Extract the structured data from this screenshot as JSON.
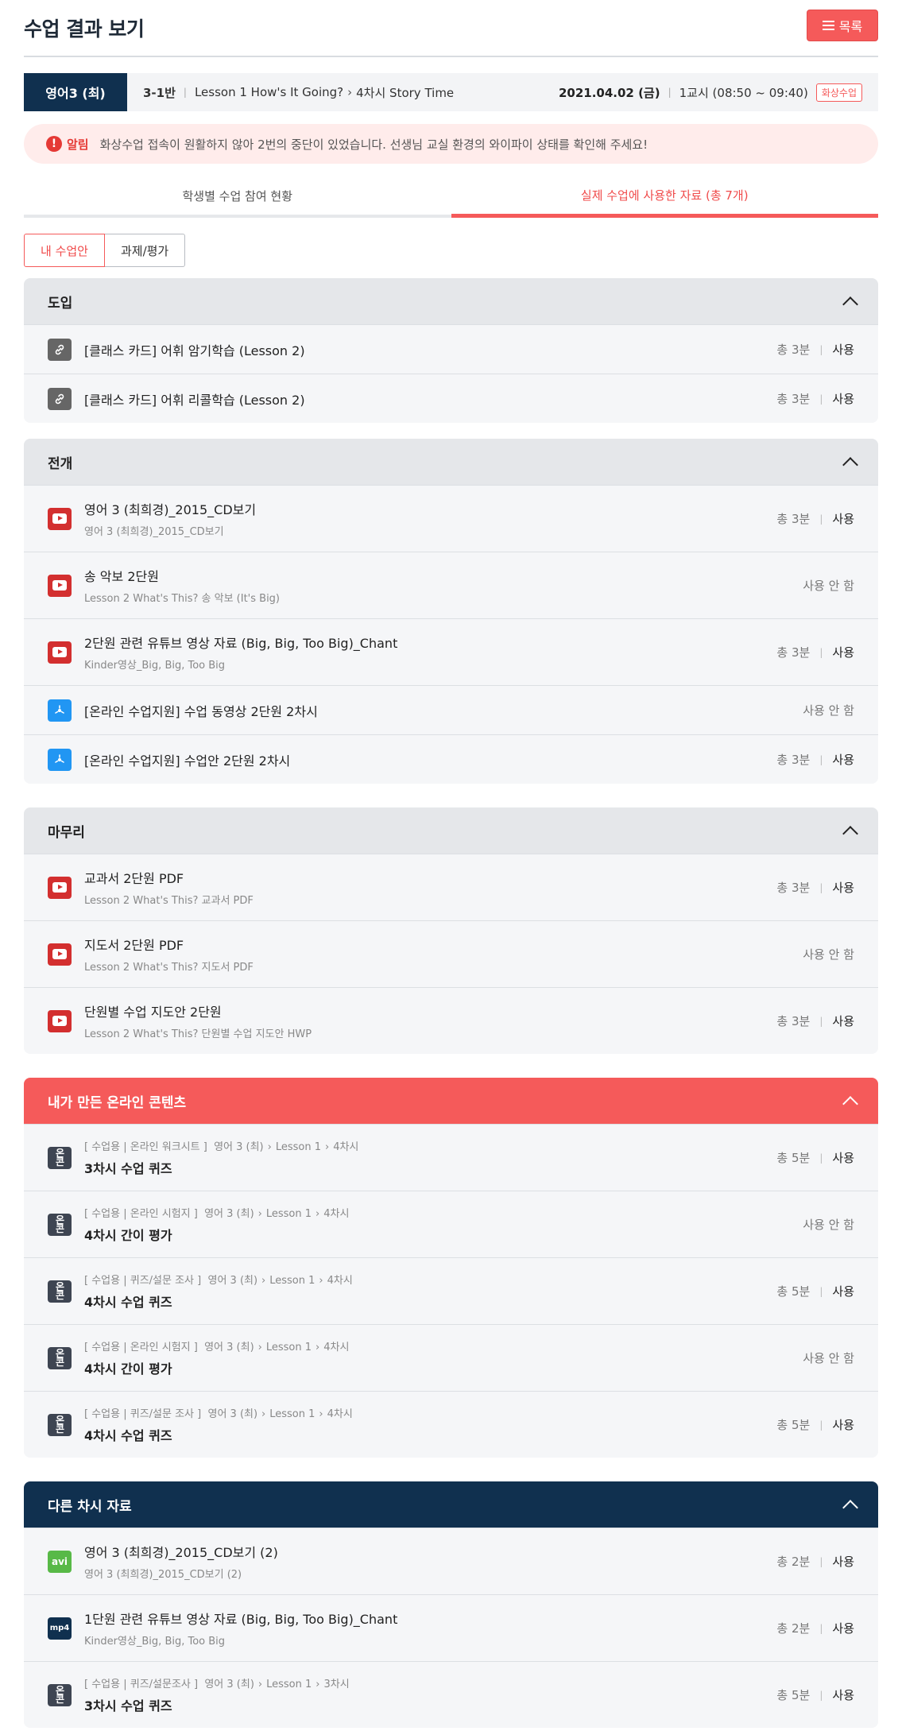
{
  "header": {
    "title": "수업 결과 보기",
    "list_button": "목록"
  },
  "classbar": {
    "subject": "영어3 (최)",
    "class_name": "3-1반",
    "lesson": "Lesson 1 How's It Going?",
    "period": "4차시 Story Time",
    "date": "2021.04.02 (금)",
    "time": "1교시 (08:50 ~ 09:40)",
    "badge": "화상수업"
  },
  "alert": {
    "label": "알림",
    "message": "화상수업 접속이 원활하지 않아 2번의 중단이 있었습니다. 선생님 교실 환경의 와이파이 상태를 확인해 주세요!"
  },
  "tabs": [
    {
      "label": "학생별 수업 참여 현황"
    },
    {
      "label": "실제 수업에 사용한 자료 (총 7개)"
    }
  ],
  "subtabs": [
    {
      "label": "내 수업안"
    },
    {
      "label": "과제/평가"
    }
  ],
  "sections": [
    {
      "title": "도입",
      "rows": [
        {
          "icon": "link-icon",
          "title": "[클래스 카드] 어휘 암기학습 (Lesson 2)",
          "time": "총 3분",
          "status": "사용"
        },
        {
          "icon": "link-icon",
          "title": "[클래스 카드] 어휘 리콜학습 (Lesson 2)",
          "time": "총 3분",
          "status": "사용"
        }
      ]
    },
    {
      "title": "전개",
      "rows": [
        {
          "icon": "youtube-icon",
          "title": "영어 3 (최희경)_2015_CD보기",
          "sub": "영어 3 (최희경)_2015_CD보기",
          "time": "총 3분",
          "status": "사용"
        },
        {
          "icon": "youtube-icon",
          "title": "송 악보 2단원",
          "sub": "Lesson 2 What's This? 송 악보 (It's Big)",
          "status_unused": "사용 안 함"
        },
        {
          "icon": "youtube-icon",
          "title": "2단원 관련 유튜브 영상 자료 (Big, Big, Too Big)_Chant",
          "sub": "Kinder영상_Big, Big, Too Big",
          "time": "총 3분",
          "status": "사용"
        },
        {
          "icon": "online-support-icon",
          "title": "[온라인 수업지원] 수업 동영상 2단원 2차시",
          "status_unused": "사용 안 함"
        },
        {
          "icon": "online-support-icon",
          "title": "[온라인 수업지원] 수업안 2단원 2차시",
          "time": "총 3분",
          "status": "사용"
        }
      ]
    },
    {
      "title": "마무리",
      "rows": [
        {
          "icon": "youtube-icon",
          "title": "교과서 2단원 PDF",
          "sub": "Lesson 2 What's This? 교과서 PDF",
          "time": "총 3분",
          "status": "사용"
        },
        {
          "icon": "youtube-icon",
          "title": "지도서 2단원 PDF",
          "sub": "Lesson 2 What's This? 지도서 PDF",
          "status_unused": "사용 안 함"
        },
        {
          "icon": "youtube-icon",
          "title": "단원별 수업 지도안 2단원",
          "sub": "Lesson 2 What's This? 단원별 수업 지도안 HWP",
          "time": "총 3분",
          "status": "사용"
        }
      ]
    },
    {
      "title": "내가 만든 온라인 콘텐츠",
      "rows": [
        {
          "icon_text": "온|콘",
          "tag": "[ 수업용 | 온라인 워크시트 ]",
          "subject": "영어 3 (최)",
          "lesson": "Lesson 1",
          "period": "4차시",
          "title": "3차시 수업 퀴즈",
          "time": "총 5분",
          "status": "사용"
        },
        {
          "icon_text": "온|콘",
          "tag": "[ 수업용 | 온라인 시험지 ]",
          "subject": "영어 3 (최)",
          "lesson": "Lesson 1",
          "period": "4차시",
          "title": "4차시 간이 평가",
          "status_unused": "사용 안 함"
        },
        {
          "icon_text": "온|콘",
          "tag": "[ 수업용 | 퀴즈/설문 조사 ]",
          "subject": "영어 3 (최)",
          "lesson": "Lesson 1",
          "period": "4차시",
          "title": "4차시 수업 퀴즈",
          "time": "총 5분",
          "status": "사용"
        },
        {
          "icon_text": "온|콘",
          "tag": "[ 수업용 | 온라인 시험지 ]",
          "subject": "영어 3 (최)",
          "lesson": "Lesson 1",
          "period": "4차시",
          "title": "4차시 간이 평가",
          "status_unused": "사용 안 함"
        },
        {
          "icon_text": "온|콘",
          "tag": "[ 수업용 | 퀴즈/설문 조사 ]",
          "subject": "영어 3 (최)",
          "lesson": "Lesson 1",
          "period": "4차시",
          "title": "4차시 수업 퀴즈",
          "time": "총 5분",
          "status": "사용"
        }
      ]
    },
    {
      "title": "다른 차시 자료",
      "rows": [
        {
          "icon_text": "avi",
          "title": "영어 3 (최희경)_2015_CD보기 (2)",
          "sub": "영어 3 (최희경)_2015_CD보기 (2)",
          "time": "총 2분",
          "status": "사용"
        },
        {
          "icon_text": "mp4",
          "title": "1단원 관련 유튜브 영상 자료 (Big, Big, Too Big)_Chant",
          "sub": "Kinder영상_Big, Big, Too Big",
          "time": "총 2분",
          "status": "사용"
        },
        {
          "icon_text": "온|콘",
          "tag": "[ 수업용 | 퀴즈/설문조사 ]",
          "subject": "영어 3 (최)",
          "lesson": "Lesson 1",
          "period": "3차시",
          "title": "3차시 수업 퀴즈",
          "time": "총 5분",
          "status": "사용"
        }
      ]
    }
  ],
  "colors": {
    "accent": "#f55a5a",
    "navy": "#10304f",
    "youtube": "#d32f2f",
    "online_support": "#2196f3",
    "avi": "#58b947"
  }
}
